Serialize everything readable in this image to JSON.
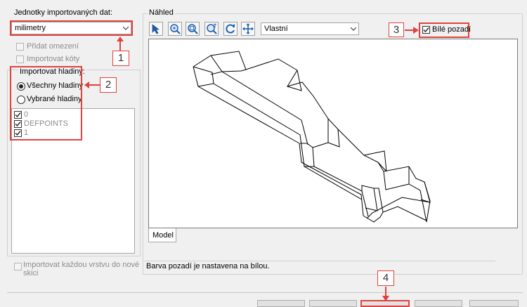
{
  "left_panel": {
    "units_label": "Jednotky importovaných dat:",
    "units_value": "milimetry",
    "add_constraints_label": "Přidat omezení",
    "import_dimensions_label": "Importovat kóty",
    "layers_group_title": "Importovat hladiny:",
    "all_layers_label": "Všechny hladiny",
    "selected_layers_label": "Vybrané hladiny",
    "layers": [
      {
        "name": "0",
        "checked": true
      },
      {
        "name": "DEFPOINTS",
        "checked": true
      },
      {
        "name": "1",
        "checked": true
      }
    ],
    "import_each_layer_label_line1": "Importovat každou vrstvu do nové",
    "import_each_layer_label_line2": "skici"
  },
  "preview": {
    "group_title": "Náhled",
    "view_value": "Vlastní",
    "white_background_label": "Bílé pozadí",
    "tab_model": "Model",
    "status_text": "Barva pozadí je nastavena na bílou."
  },
  "callouts": [
    "1",
    "2",
    "3",
    "4"
  ],
  "colors": {
    "callout_red": "#e0433e",
    "panel_bg": "#f0f0f0"
  },
  "icons": [
    "select-tool-icon",
    "zoom-window-icon",
    "zoom-fit-icon",
    "zoom-icon",
    "rotate-icon",
    "pan-icon"
  ]
}
